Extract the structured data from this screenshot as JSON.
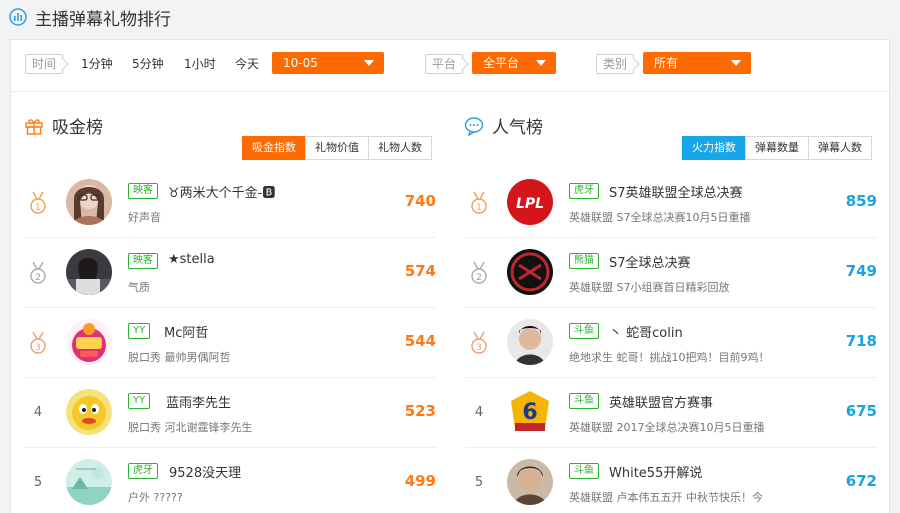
{
  "page": {
    "title": "主播弹幕礼物排行"
  },
  "filters": {
    "time_label": "时间",
    "time_options": [
      "1分钟",
      "5分钟",
      "1小时",
      "今天"
    ],
    "date_value": "10-05",
    "platform_label": "平台",
    "platform_value": "全平台",
    "category_label": "类别",
    "category_value": "所有"
  },
  "colors": {
    "accent_orange": "#ff6a00",
    "accent_blue": "#18a6e8",
    "platform_green": "#2cb32c"
  },
  "left_panel": {
    "title": "吸金榜",
    "tabs": [
      "吸金指数",
      "礼物价值",
      "礼物人数"
    ],
    "active_tab": 0,
    "rows": [
      {
        "rank": "1",
        "platform": "映客",
        "name": "♉两米大个千金-🅱",
        "sub": "好声音",
        "value": "740"
      },
      {
        "rank": "2",
        "platform": "映客",
        "name": "★stella",
        "sub": "气质",
        "value": "574"
      },
      {
        "rank": "3",
        "platform": "YY",
        "name": "Mc阿哲",
        "sub": "脱口秀 最帅男偶阿哲",
        "value": "544"
      },
      {
        "rank": "4",
        "platform": "YY",
        "name": "蓝雨李先生",
        "sub": "脱口秀 河北谢霆锋李先生",
        "value": "523"
      },
      {
        "rank": "5",
        "platform": "虎牙",
        "name": "9528没天理",
        "sub": "户外 ?????",
        "value": "499"
      }
    ]
  },
  "right_panel": {
    "title": "人气榜",
    "tabs": [
      "火力指数",
      "弹幕数量",
      "弹幕人数"
    ],
    "active_tab": 0,
    "rows": [
      {
        "rank": "1",
        "platform": "虎牙",
        "name": "S7英雄联盟全球总决赛",
        "sub": "英雄联盟 S7全球总决赛10月5日重播",
        "value": "859"
      },
      {
        "rank": "2",
        "platform": "熊猫",
        "name": "S7全球总决赛",
        "sub": "英雄联盟 S7小组赛首日精彩回放",
        "value": "749"
      },
      {
        "rank": "3",
        "platform": "斗鱼",
        "name": "丶 蛇哥colin",
        "sub": "绝地求生 蛇哥！挑战10把鸡！目前9鸡！",
        "value": "718"
      },
      {
        "rank": "4",
        "platform": "斗鱼",
        "name": "英雄联盟官方赛事",
        "sub": "英雄联盟 2017全球总决赛10月5日重播",
        "value": "675"
      },
      {
        "rank": "5",
        "platform": "斗鱼",
        "name": "White55开解说",
        "sub": "英雄联盟 卢本伟五五开 中秋节快乐！今",
        "value": "672"
      }
    ]
  },
  "avatar_texts": {
    "lpl": "LPL",
    "hero6": "6"
  }
}
